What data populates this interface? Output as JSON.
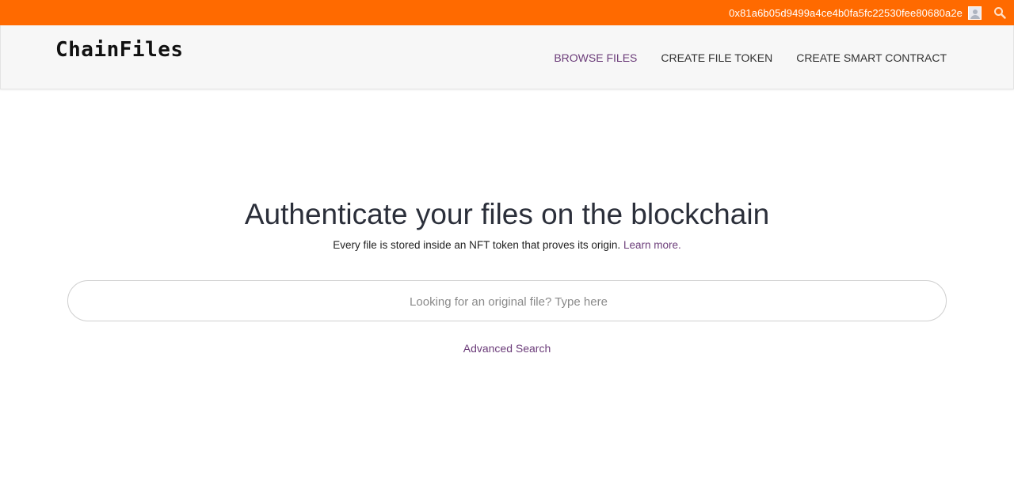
{
  "topbar": {
    "wallet_address": "0x81a6b05d9499a4ce4b0fa5fc22530fee80680a2e",
    "avatar_icon": "user-avatar-icon",
    "search_icon": "search-icon",
    "background_color": "#ff6a00"
  },
  "navbar": {
    "logo": "ChainFiles",
    "items": [
      {
        "label": "BROWSE FILES",
        "active": true
      },
      {
        "label": "CREATE FILE TOKEN",
        "active": false
      },
      {
        "label": "CREATE SMART CONTRACT",
        "active": false
      }
    ],
    "active_color": "#6c3d7a"
  },
  "hero": {
    "title": "Authenticate your files on the blockchain",
    "subtitle": "Every file is stored inside an NFT token that proves its origin.",
    "learn_more": "Learn more."
  },
  "search": {
    "placeholder": "Looking for an original file? Type here",
    "value": ""
  },
  "advanced_search": {
    "label": "Advanced Search"
  }
}
